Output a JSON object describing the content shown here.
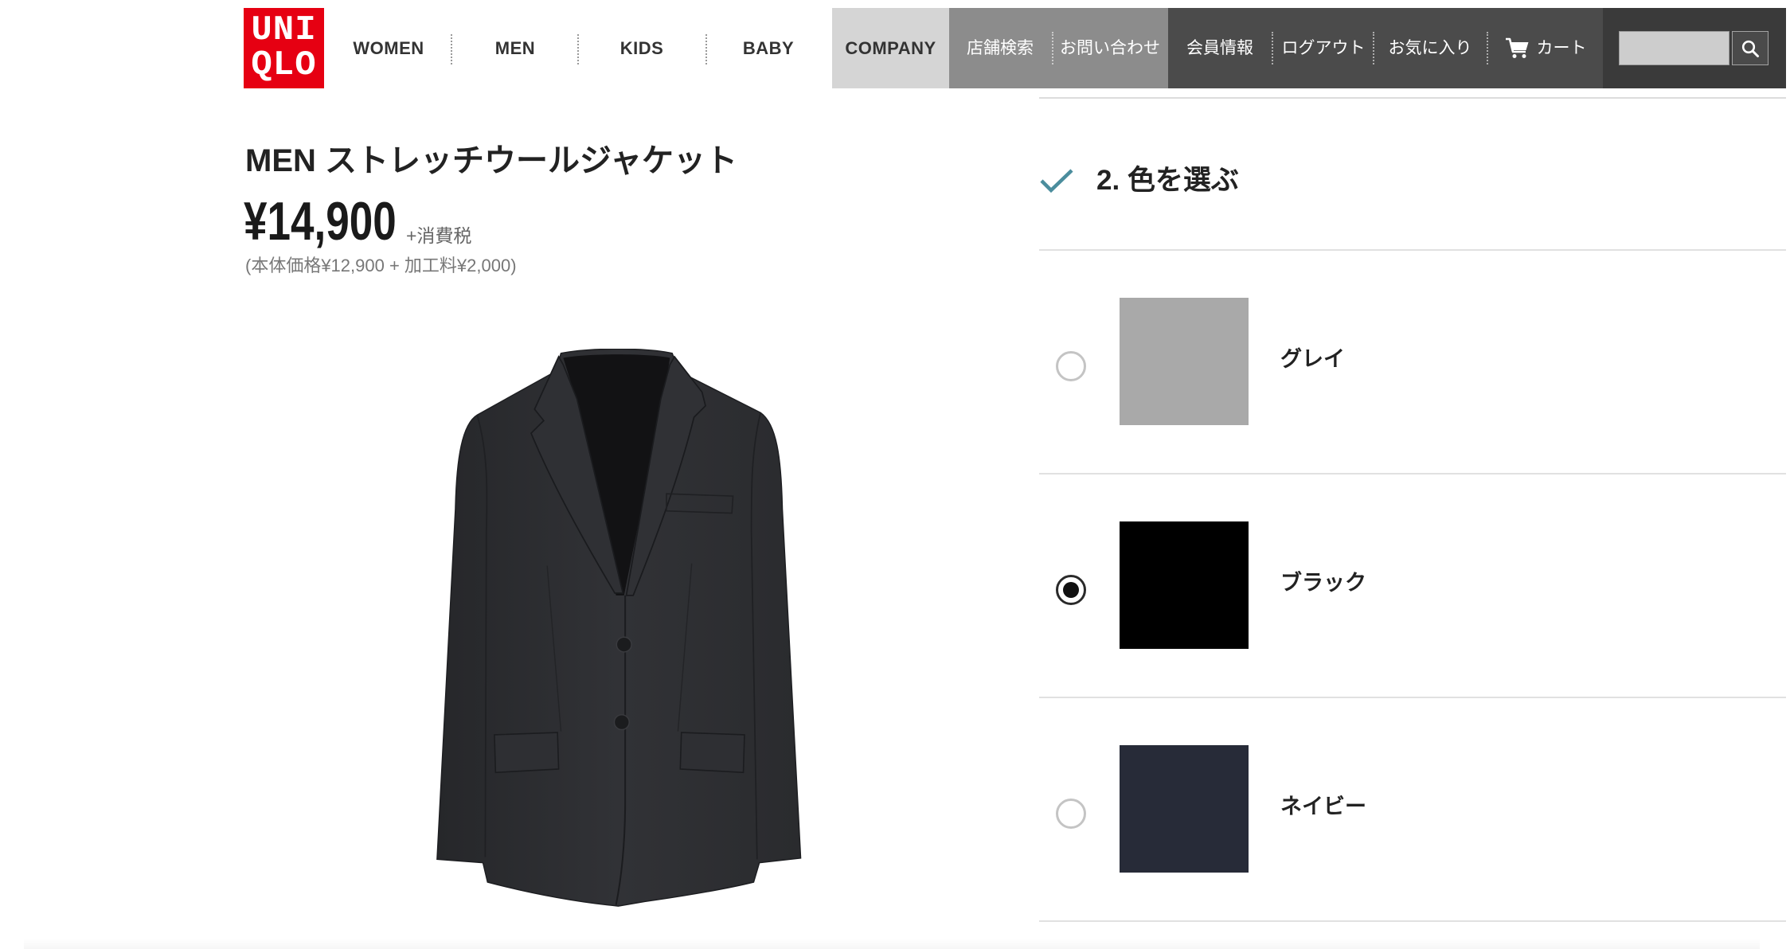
{
  "theme": {
    "brand_red": "#e60012",
    "accent_teal": "#4b8d9d",
    "header_light": "#d5d5d5",
    "header_mid": "#8c8c8c",
    "header_dark": "#4b4b4b",
    "header_darkest": "#3a3a3a"
  },
  "header": {
    "logo": {
      "line1": "UNI",
      "line2": "QLO"
    },
    "nav": [
      {
        "label": "WOMEN"
      },
      {
        "label": "MEN"
      },
      {
        "label": "KIDS"
      },
      {
        "label": "BABY"
      }
    ],
    "company": {
      "label": "COMPANY"
    },
    "store_links": [
      {
        "label": "店舗検索"
      },
      {
        "label": "お問い合わせ"
      }
    ],
    "account_links": [
      {
        "label": "会員情報"
      },
      {
        "label": "ログアウト"
      },
      {
        "label": "お気に入り"
      }
    ],
    "cart": {
      "label": "カート",
      "icon": "cart-icon"
    },
    "search": {
      "icon": "search-icon"
    }
  },
  "product": {
    "title": "MEN ストレッチウールジャケット",
    "price": "¥14,900",
    "tax_note": "+消費税",
    "price_breakdown": "(本体価格¥12,900 + 加工料¥2,000)"
  },
  "color_step": {
    "heading": "2. 色を選ぶ",
    "completed_icon": "checkmark-icon",
    "options": [
      {
        "name": "グレイ",
        "swatch": "#a9a9a9",
        "selected": false
      },
      {
        "name": "ブラック",
        "swatch": "#000000",
        "selected": true
      },
      {
        "name": "ネイビー",
        "swatch": "#272b38",
        "selected": false
      }
    ]
  }
}
